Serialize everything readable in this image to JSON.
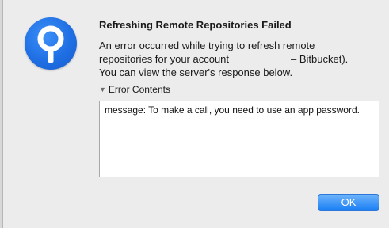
{
  "dialog": {
    "title": "Refreshing Remote Repositories Failed",
    "message_lines": [
      "An error occurred while trying to refresh remote",
      "repositories for your account",
      "– Bitbucket).",
      "You can view the server's response below."
    ],
    "disclosure_label": "Error Contents",
    "disclosure_icon": "triangle-down-icon",
    "error_contents": "message: To make a call, you need to use an app password.",
    "ok_label": "OK"
  },
  "app_icon": {
    "name": "sourcetree-icon",
    "color": "#1f6fe4"
  },
  "colors": {
    "dialog_background": "#ececec",
    "button_accent": "#1e81f5"
  }
}
